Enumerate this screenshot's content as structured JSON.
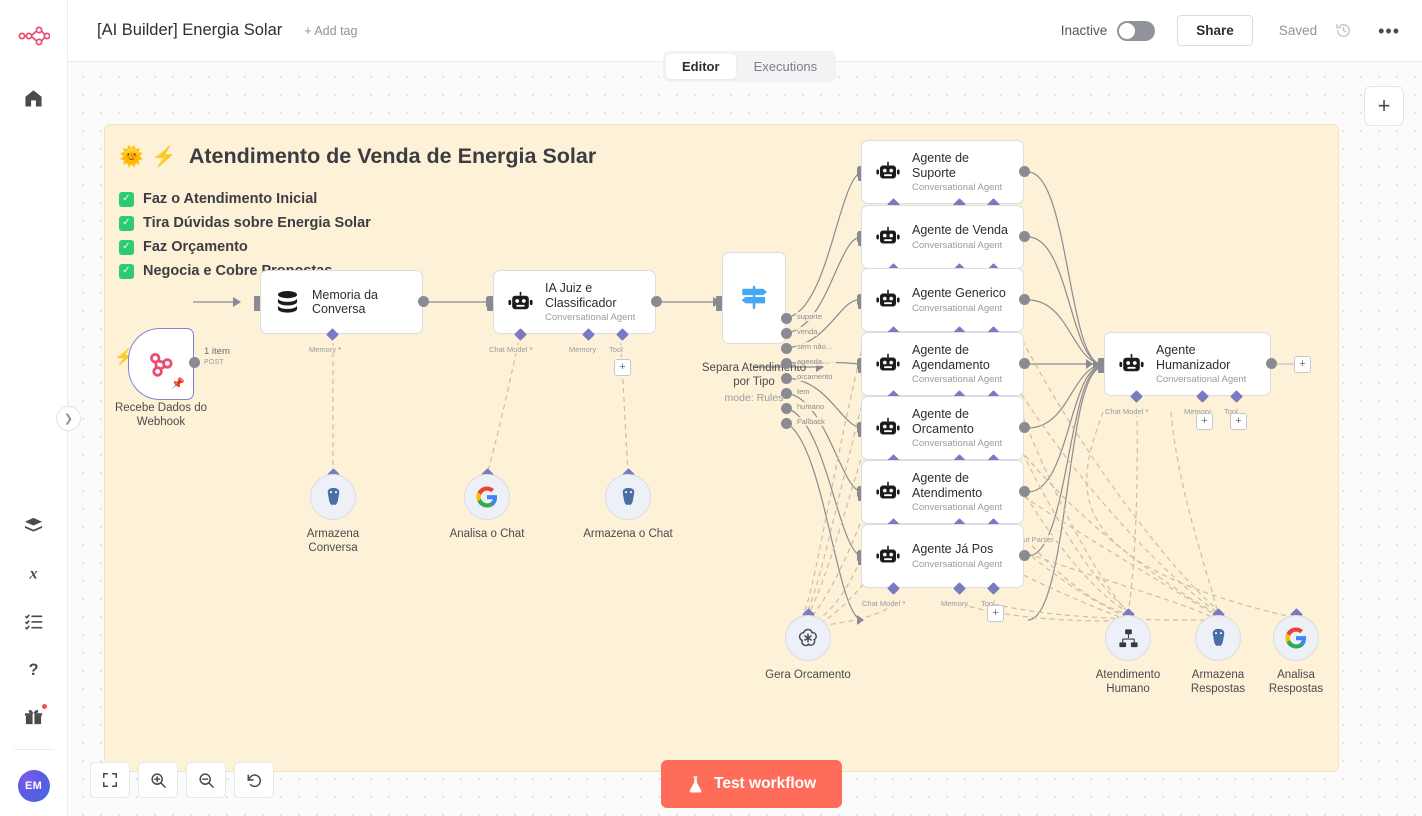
{
  "app": {
    "logo_icon": "n8n-logo"
  },
  "sidebar": {
    "items": [
      {
        "icon": "home-icon",
        "name": "overview"
      },
      {
        "icon": "templates-icon",
        "name": "templates"
      },
      {
        "icon": "variables-icon",
        "name": "variables"
      },
      {
        "icon": "insights-icon",
        "name": "insights"
      },
      {
        "icon": "help-icon",
        "name": "help"
      },
      {
        "icon": "gift-icon",
        "name": "whats-new",
        "badge": true
      }
    ],
    "avatar_initials": "EM",
    "collapse_icon": "chevron-right-icon"
  },
  "header": {
    "title": "[AI Builder] Energia Solar",
    "add_tag_label": "+ Add tag",
    "inactive_label": "Inactive",
    "share_label": "Share",
    "saved_label": "Saved",
    "history_icon": "history-icon",
    "more_icon": "ellipsis-icon",
    "activate_toggle_state": "off"
  },
  "tabs": [
    {
      "label": "Editor",
      "active": true
    },
    {
      "label": "Executions",
      "active": false
    }
  ],
  "canvas": {
    "add_node_label": "+",
    "sticky": {
      "emoji_sun": "🌞",
      "emoji_bolt": "⚡",
      "title": "Atendimento de Venda de Energia Solar",
      "checklist": [
        "Faz o Atendimento Inicial",
        "Tira Dúvidas sobre Energia Solar",
        "Faz Orçamento",
        "Negocia e Cobre Propostas"
      ]
    },
    "connection_label": "1 item",
    "webhook_method": "POST",
    "nodes": {
      "webhook": {
        "caption": "Recebe Dados do\nWebhook",
        "icon": "webhook-icon"
      },
      "memoria": {
        "name": "Memoria da\nConversa",
        "icon": "database-icon"
      },
      "juiz": {
        "name": "IA Juiz e\nClassificador",
        "subtitle": "Conversational Agent",
        "icon": "robot-icon"
      },
      "switch": {
        "caption": "Separa Atendimento\npor Tipo",
        "mode": "mode: Rules",
        "icon": "switch-icon"
      },
      "humanizador": {
        "name": "Agente\nHumanizador",
        "subtitle": "Conversational Agent",
        "icon": "robot-icon"
      }
    },
    "switch_outputs": [
      "suporte",
      "venda",
      "sem não te...",
      "agendamen...",
      "orcamento",
      "tem",
      "humano",
      "Fallback"
    ],
    "agents": [
      {
        "name": "Agente de\nSuporte",
        "subtitle": "Conversational Agent"
      },
      {
        "name": "Agente de Venda",
        "subtitle": "Conversational Agent"
      },
      {
        "name": "Agente Generico",
        "subtitle": "Conversational Agent"
      },
      {
        "name": "Agente de\nAgendamento",
        "subtitle": "Conversational Agent"
      },
      {
        "name": "Agente de\nOrcamento",
        "subtitle": "Conversational Agent"
      },
      {
        "name": "Agente de\nAtendimento",
        "subtitle": "Conversational Agent"
      },
      {
        "name": "Agente Já Pos",
        "subtitle": "Conversational Agent"
      }
    ],
    "port_labels": {
      "chat_model": "Chat Model",
      "memory": "Memory",
      "tool": "Tool",
      "output_parser": "Output Parser",
      "required_mark": "*"
    },
    "subnodes": [
      {
        "caption": "Armazena\nConversa",
        "icon": "postgres-icon"
      },
      {
        "caption": "Analisa o Chat",
        "icon": "google-icon"
      },
      {
        "caption": "Armazena o Chat",
        "icon": "postgres-icon"
      },
      {
        "caption": "Gera Orcamento",
        "icon": "openai-icon"
      },
      {
        "caption": "Atendimento\nHumano",
        "icon": "sitemap-icon"
      },
      {
        "caption": "Armazena\nRespostas",
        "icon": "postgres-icon"
      },
      {
        "caption": "Analisa\nRespostas",
        "icon": "google-icon"
      }
    ]
  },
  "toolbar": {
    "zoom_to_fit": "fit-icon",
    "zoom_in": "zoom-in-icon",
    "zoom_out": "zoom-out-icon",
    "reset_zoom": "reset-icon",
    "test_label": "Test workflow",
    "test_icon": "flask-icon"
  },
  "colors": {
    "accent": "#ff6d5a",
    "sticky_bg": "#fdf2d7",
    "brand": "#ea4b71",
    "check_green": "#2ecc71"
  }
}
